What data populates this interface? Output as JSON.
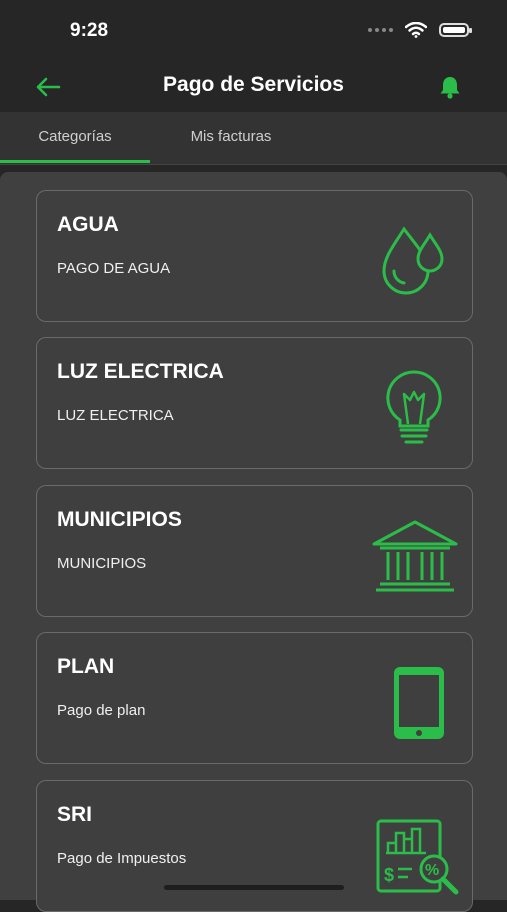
{
  "status": {
    "time": "9:28"
  },
  "header": {
    "title": "Pago de Servicios",
    "back_icon": "arrow-left-icon",
    "bell_icon": "bell-icon"
  },
  "tabs": [
    {
      "label": "Categorías",
      "active": true
    },
    {
      "label": "Mis facturas",
      "active": false
    }
  ],
  "accent_color": "#2bbd4a",
  "categories": [
    {
      "title": "AGUA",
      "subtitle": "PAGO DE AGUA",
      "icon": "water-drops-icon"
    },
    {
      "title": "LUZ ELECTRICA",
      "subtitle": "LUZ ELECTRICA",
      "icon": "lightbulb-icon"
    },
    {
      "title": "MUNICIPIOS",
      "subtitle": "MUNICIPIOS",
      "icon": "building-columns-icon"
    },
    {
      "title": "PLAN",
      "subtitle": "Pago de plan",
      "icon": "smartphone-icon"
    },
    {
      "title": "SRI",
      "subtitle": "Pago de Impuestos",
      "icon": "tax-report-icon"
    }
  ]
}
